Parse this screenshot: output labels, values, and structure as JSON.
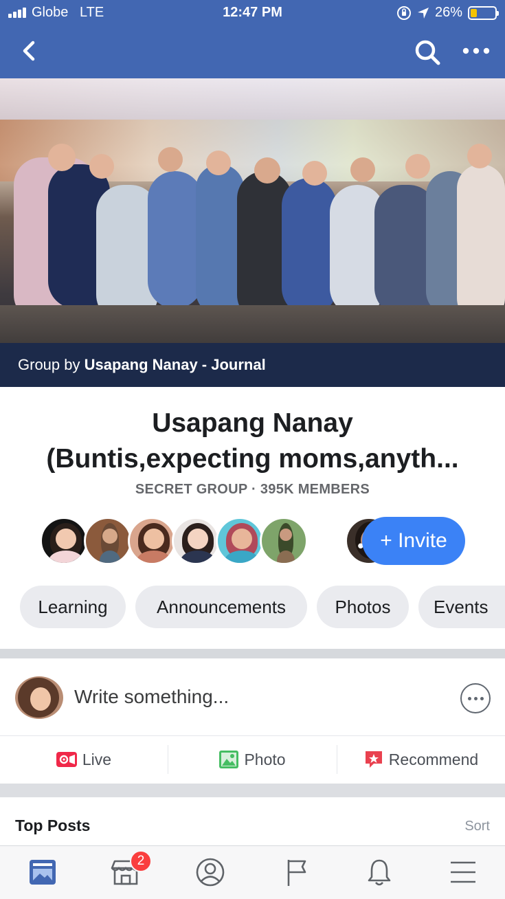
{
  "status_bar": {
    "carrier": "Globe",
    "network": "LTE",
    "time": "12:47 PM",
    "battery": "26%",
    "battery_level": 0.26
  },
  "nav": {
    "back_icon": "chevron-left-icon",
    "search_icon": "search-icon",
    "more_icon": "more-horizontal-icon"
  },
  "cover": {
    "caption_prefix": "Group by",
    "caption_owner": "Usapang Nanay - Journal"
  },
  "group": {
    "title_line1": "Usapang Nanay",
    "title_line2": "(Buntis,expecting moms,anyth...",
    "meta": "SECRET GROUP · 395K MEMBERS",
    "more_members": "•••",
    "invite_label": "+ Invite"
  },
  "chips": [
    "Learning",
    "Announcements",
    "Photos",
    "Events"
  ],
  "composer": {
    "placeholder": "Write something..."
  },
  "actions": {
    "live": "Live",
    "photo": "Photo",
    "recommend": "Recommend"
  },
  "feed": {
    "section_title": "Top Posts",
    "sort_label": "Sort"
  },
  "tabbar": {
    "marketplace_badge": "2",
    "tabs": [
      "news-feed-icon",
      "marketplace-icon",
      "profile-icon",
      "pages-icon",
      "notifications-icon",
      "menu-icon"
    ]
  },
  "colors": {
    "brand": "#4267b2",
    "invite": "#3b82f6",
    "caption_bg": "#1c2a4a",
    "badge": "#fa3e3e"
  }
}
